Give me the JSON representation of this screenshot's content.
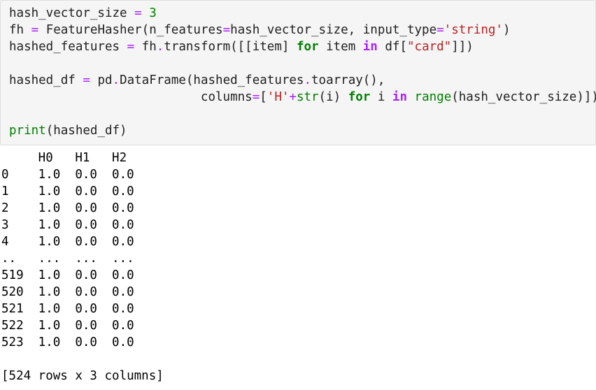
{
  "code_cell": {
    "lines": [
      [
        {
          "t": "hash_vector_size ",
          "c": "plain"
        },
        {
          "t": "=",
          "c": "op-plain"
        },
        {
          "t": " ",
          "c": "plain"
        },
        {
          "t": "3",
          "c": "num"
        }
      ],
      [
        {
          "t": "fh ",
          "c": "plain"
        },
        {
          "t": "=",
          "c": "op-plain"
        },
        {
          "t": " FeatureHasher(n_features",
          "c": "plain"
        },
        {
          "t": "=",
          "c": "op-plain"
        },
        {
          "t": "hash_vector_size, input_type",
          "c": "plain"
        },
        {
          "t": "=",
          "c": "op-plain"
        },
        {
          "t": "'string'",
          "c": "str"
        },
        {
          "t": ")",
          "c": "plain"
        }
      ],
      [
        {
          "t": "hashed_features ",
          "c": "plain"
        },
        {
          "t": "=",
          "c": "op-plain"
        },
        {
          "t": " fh",
          "c": "plain"
        },
        {
          "t": ".",
          "c": "op-plain"
        },
        {
          "t": "transform([[item] ",
          "c": "plain"
        },
        {
          "t": "for",
          "c": "kw"
        },
        {
          "t": " item ",
          "c": "plain"
        },
        {
          "t": "in",
          "c": "op"
        },
        {
          "t": " df[",
          "c": "plain"
        },
        {
          "t": "\"card\"",
          "c": "str"
        },
        {
          "t": "]])",
          "c": "plain"
        }
      ],
      [],
      [
        {
          "t": "hashed_df ",
          "c": "plain"
        },
        {
          "t": "=",
          "c": "op-plain"
        },
        {
          "t": " pd",
          "c": "plain"
        },
        {
          "t": ".",
          "c": "op-plain"
        },
        {
          "t": "DataFrame(hashed_features",
          "c": "plain"
        },
        {
          "t": ".",
          "c": "op-plain"
        },
        {
          "t": "toarray(),",
          "c": "plain"
        }
      ],
      [
        {
          "t": "                          columns",
          "c": "plain"
        },
        {
          "t": "=",
          "c": "op-plain"
        },
        {
          "t": "[",
          "c": "plain"
        },
        {
          "t": "'H'",
          "c": "str"
        },
        {
          "t": "+",
          "c": "op-plain"
        },
        {
          "t": "str",
          "c": "builtin"
        },
        {
          "t": "(i) ",
          "c": "plain"
        },
        {
          "t": "for",
          "c": "kw"
        },
        {
          "t": " i ",
          "c": "plain"
        },
        {
          "t": "in",
          "c": "op"
        },
        {
          "t": " ",
          "c": "plain"
        },
        {
          "t": "range",
          "c": "builtin"
        },
        {
          "t": "(hash_vector_size)])",
          "c": "plain"
        }
      ],
      [],
      [
        {
          "t": "print",
          "c": "builtin"
        },
        {
          "t": "(hashed_df)",
          "c": "plain"
        }
      ]
    ]
  },
  "output": {
    "lines": [
      "     H0   H1   H2",
      "0    1.0  0.0  0.0",
      "1    1.0  0.0  0.0",
      "2    1.0  0.0  0.0",
      "3    1.0  0.0  0.0",
      "4    1.0  0.0  0.0",
      "..   ...  ...  ...",
      "519  1.0  0.0  0.0",
      "520  1.0  0.0  0.0",
      "521  1.0  0.0  0.0",
      "522  1.0  0.0  0.0",
      "523  1.0  0.0  0.0",
      "",
      "[524 rows x 3 columns]"
    ]
  }
}
